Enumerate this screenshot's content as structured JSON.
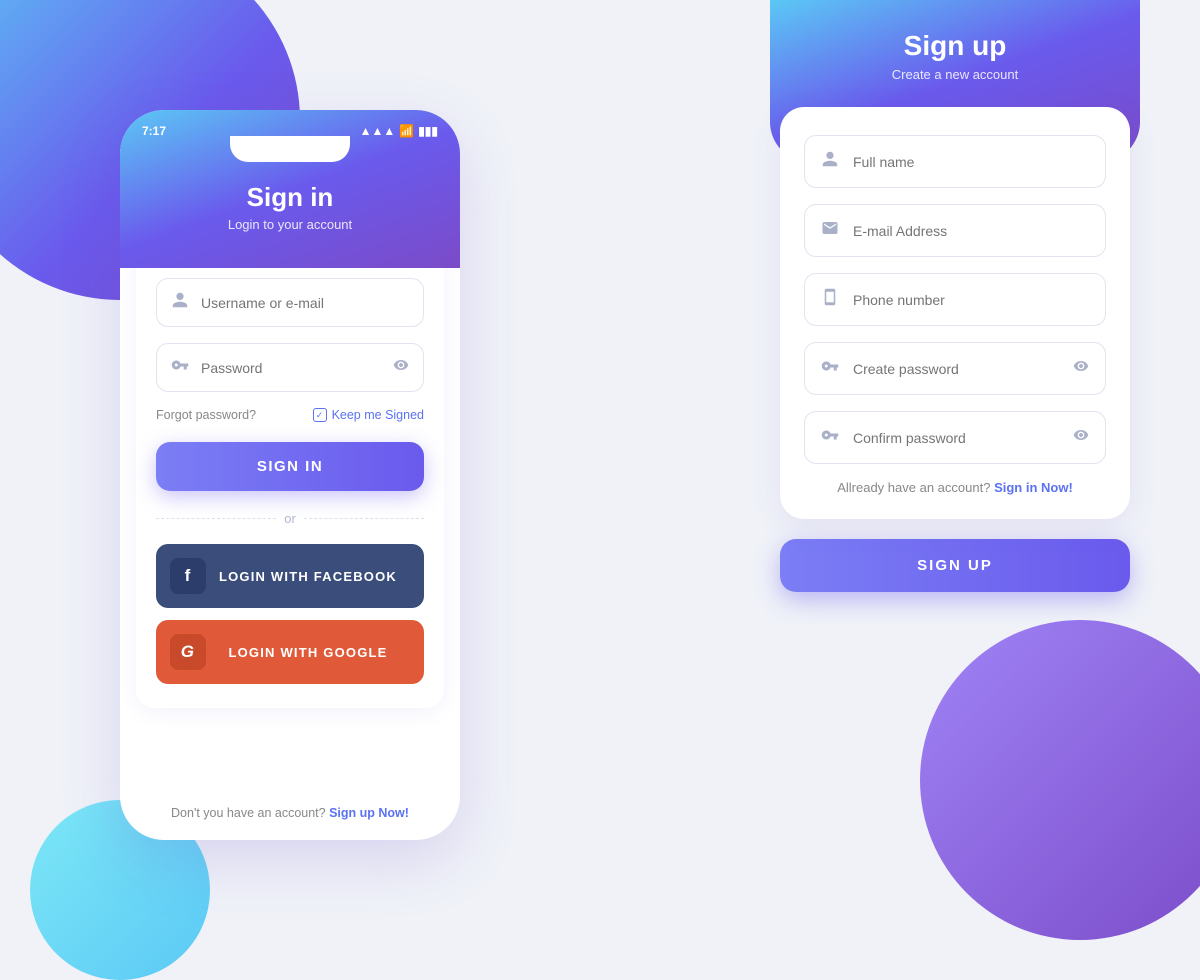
{
  "background": {
    "color": "#f0f2f8"
  },
  "left_phone": {
    "status_time": "7:17",
    "header": {
      "title": "Sign in",
      "subtitle": "Login to your account"
    },
    "form": {
      "username_placeholder": "Username or e-mail",
      "password_placeholder": "Password",
      "forgot_label": "Forgot password?",
      "keep_signed_label": "Keep me Signed",
      "sign_in_button": "SIGN IN",
      "or_label": "or",
      "facebook_button": "LOGIN WITH FACEBOOK",
      "google_button": "LOGIN WITH GOOGLE",
      "no_account_text": "Don't you have an account?",
      "sign_up_link": "Sign up Now!"
    }
  },
  "right_phone": {
    "header": {
      "title": "Sign up",
      "subtitle": "Create a new account"
    },
    "form": {
      "fullname_placeholder": "Full name",
      "email_placeholder": "E-mail Address",
      "phone_placeholder": "Phone number",
      "password_placeholder": "Create password",
      "confirm_placeholder": "Confirm password",
      "already_text": "Allready have an account?",
      "sign_in_link": "Sign in Now!",
      "sign_up_button": "SIGN UP"
    }
  }
}
